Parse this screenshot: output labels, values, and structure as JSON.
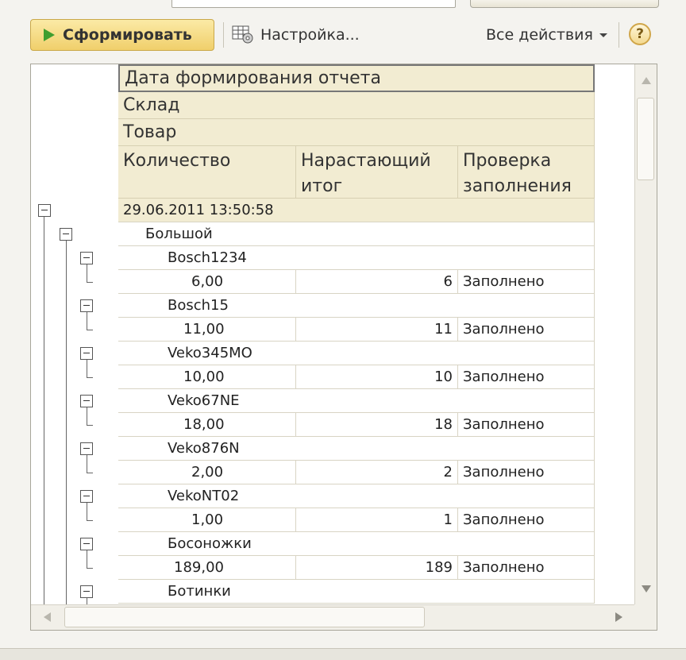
{
  "toolbar": {
    "generate_label": "Сформировать",
    "settings_label": "Настройка...",
    "all_actions_label": "Все действия",
    "help_label": "?"
  },
  "report": {
    "headers": {
      "date": "Дата формирования отчета",
      "warehouse": "Склад",
      "product": "Товар",
      "quantity": "Количество",
      "running_total_line1": "Нарастающий",
      "running_total_line2": "итог",
      "check_line1": "Проверка",
      "check_line2": "заполнения"
    },
    "date_row": "29.06.2011 13:50:58",
    "warehouse_row": "Большой",
    "items": [
      {
        "name": "Bosch1234",
        "quantity": "6,00",
        "total": "6",
        "status": "Заполнено"
      },
      {
        "name": "Bosch15",
        "quantity": "11,00",
        "total": "11",
        "status": "Заполнено"
      },
      {
        "name": "Veko345MO",
        "quantity": "10,00",
        "total": "10",
        "status": "Заполнено"
      },
      {
        "name": "Veko67NE",
        "quantity": "18,00",
        "total": "18",
        "status": "Заполнено"
      },
      {
        "name": "Veko876N",
        "quantity": "2,00",
        "total": "2",
        "status": "Заполнено"
      },
      {
        "name": "VekoNT02",
        "quantity": "1,00",
        "total": "1",
        "status": "Заполнено"
      },
      {
        "name": "Босоножки",
        "quantity": "189,00",
        "total": "189",
        "status": "Заполнено"
      },
      {
        "name": "Ботинки"
      }
    ]
  },
  "colors": {
    "header_bg": "#f2ecd2",
    "run_button": "#f0cf6b",
    "play_icon": "#3f9e2f"
  }
}
